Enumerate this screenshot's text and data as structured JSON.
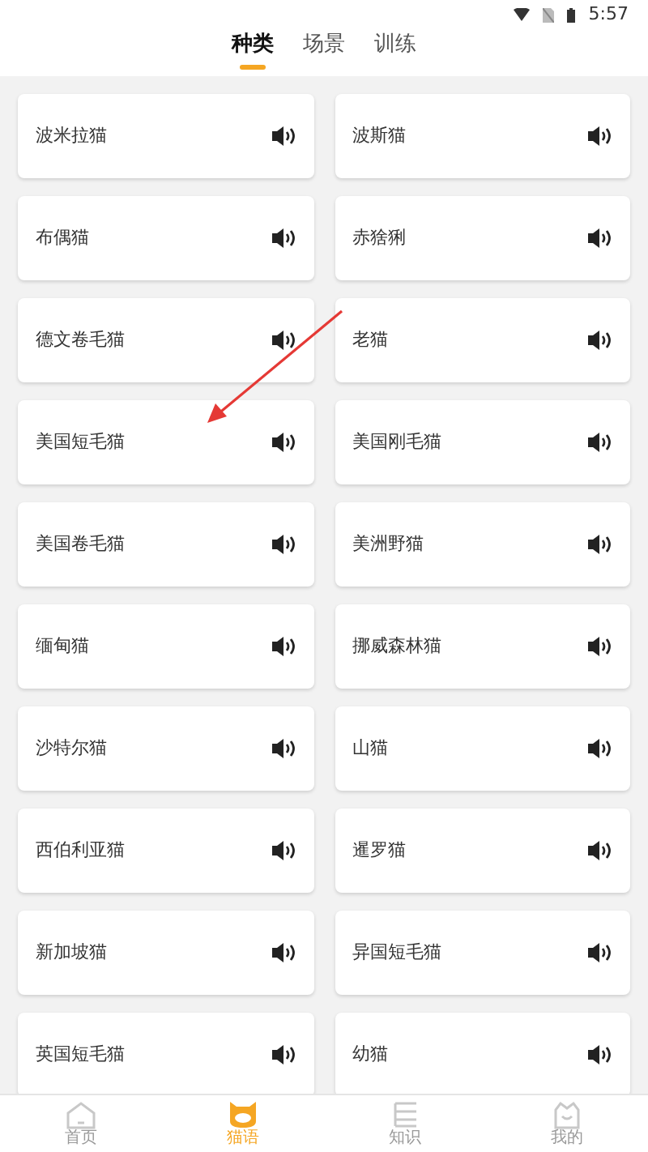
{
  "status_bar": {
    "time": "5:57"
  },
  "tabs": [
    {
      "label": "种类",
      "selected": true
    },
    {
      "label": "场景",
      "selected": false
    },
    {
      "label": "训练",
      "selected": false
    }
  ],
  "items": [
    {
      "name": "波米拉猫"
    },
    {
      "name": "波斯猫"
    },
    {
      "name": "布偶猫"
    },
    {
      "name": "赤猞猁"
    },
    {
      "name": "德文卷毛猫"
    },
    {
      "name": "老猫"
    },
    {
      "name": "美国短毛猫"
    },
    {
      "name": "美国刚毛猫"
    },
    {
      "name": "美国卷毛猫"
    },
    {
      "name": "美洲野猫"
    },
    {
      "name": "缅甸猫"
    },
    {
      "name": "挪威森林猫"
    },
    {
      "name": "沙特尔猫"
    },
    {
      "name": "山猫"
    },
    {
      "name": "西伯利亚猫"
    },
    {
      "name": "暹罗猫"
    },
    {
      "name": "新加坡猫"
    },
    {
      "name": "异国短毛猫"
    },
    {
      "name": "英国短毛猫"
    },
    {
      "name": "幼猫"
    }
  ],
  "bottom_nav": [
    {
      "label": "首页",
      "kind": "home",
      "selected": false
    },
    {
      "label": "猫语",
      "kind": "cat",
      "selected": true
    },
    {
      "label": "知识",
      "kind": "book",
      "selected": false
    },
    {
      "label": "我的",
      "kind": "profile",
      "selected": false
    }
  ]
}
